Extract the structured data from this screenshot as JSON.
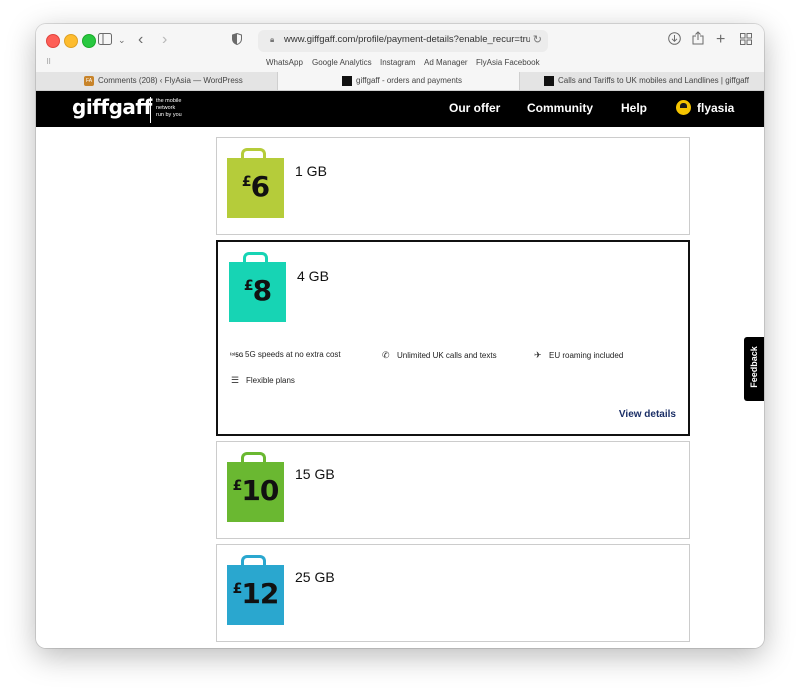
{
  "browser": {
    "url": "www.giffgaff.com/profile/payment-details?enable_recur=true#g",
    "bookmarks": [
      "WhatsApp",
      "Google Analytics",
      "Instagram",
      "Ad Manager",
      "FlyAsia Facebook"
    ],
    "tabs": [
      {
        "label": "Comments (208) ‹ FlyAsia — WordPress",
        "favicon": "FA"
      },
      {
        "label": "giffgaff - orders and payments",
        "active": true
      },
      {
        "label": "Calls and Tariffs to UK mobiles and Landlines | giffgaff"
      }
    ]
  },
  "site": {
    "logo": "giffgaff",
    "tagline": [
      "the mobile",
      "network",
      "run by you"
    ],
    "nav": [
      "Our offer",
      "Community",
      "Help"
    ],
    "username": "flyasia"
  },
  "plans": [
    {
      "price": "6",
      "currency": "£",
      "data": "1 GB",
      "color": "#b5cc3a"
    },
    {
      "price": "8",
      "currency": "£",
      "data": "4 GB",
      "color": "#17d4b4",
      "selected": true,
      "features": [
        {
          "icon": "5g-icon",
          "label": "5G speeds at no extra cost"
        },
        {
          "icon": "phone-call-icon",
          "label": "Unlimited UK calls and texts"
        },
        {
          "icon": "plane-icon",
          "label": "EU roaming included"
        },
        {
          "icon": "flexible-plans-icon",
          "label": "Flexible plans"
        }
      ],
      "link": "View details"
    },
    {
      "price": "10",
      "currency": "£",
      "data": "15 GB",
      "color": "#6ab831"
    },
    {
      "price": "12",
      "currency": "£",
      "data": "25 GB",
      "color": "#2aa7cf"
    }
  ],
  "feedback": "Feedback"
}
